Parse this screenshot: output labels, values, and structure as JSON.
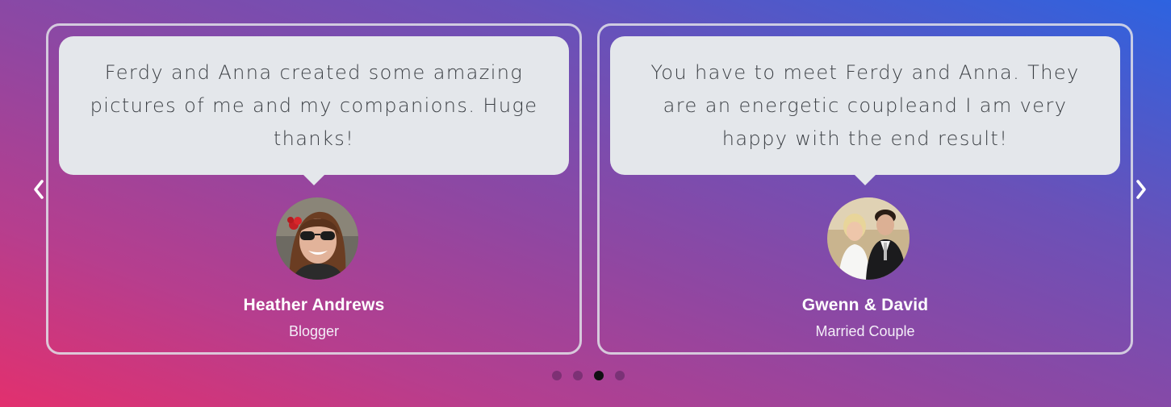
{
  "testimonials": [
    {
      "quote": "Ferdy and Anna created some amazing pictures of me and my companions. Huge thanks!",
      "name": "Heather Andrews",
      "role": "Blogger"
    },
    {
      "quote": "You have to meet Ferdy and Anna. They are an energetic coupleand I am very happy with the end result!",
      "name": "Gwenn & David",
      "role": "Married Couple"
    }
  ],
  "carousel": {
    "prev_icon": "chevron-left-icon",
    "next_icon": "chevron-right-icon",
    "dot_count": 4,
    "active_dot": 3
  },
  "colors": {
    "gradient_start": "#e2306e",
    "gradient_end": "#2d63e0",
    "bubble": "#e4e7eb",
    "card_border": "#e1e1e8"
  }
}
